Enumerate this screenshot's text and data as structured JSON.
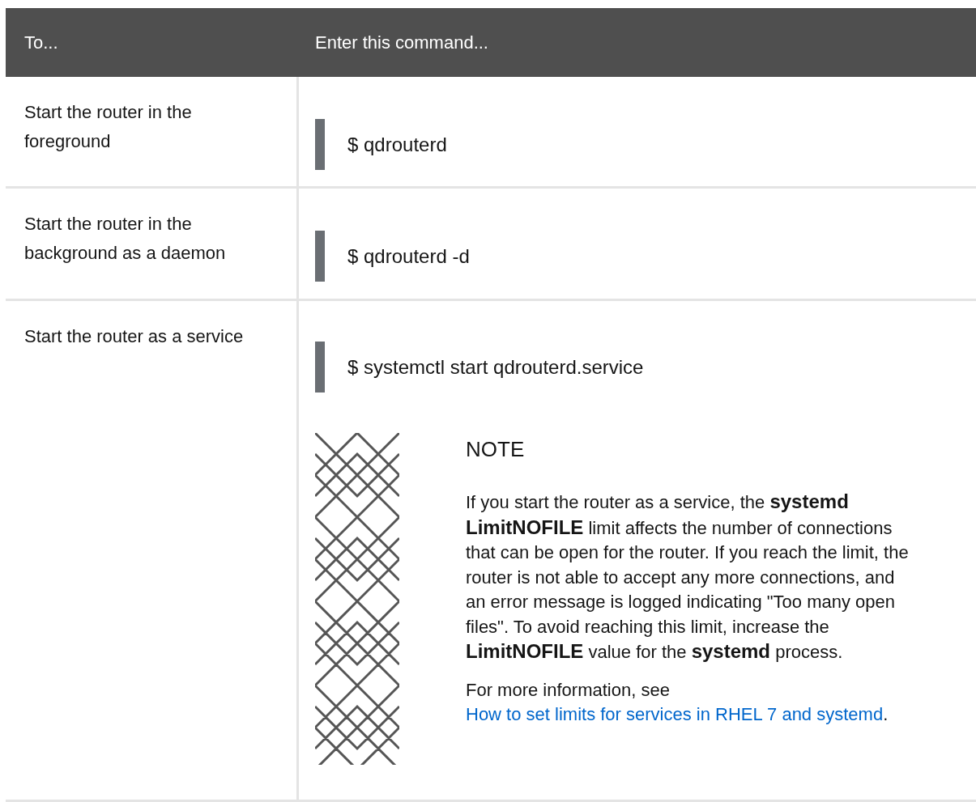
{
  "table": {
    "columns": [
      "To...",
      "Enter this command..."
    ],
    "rows": [
      {
        "task": "Start the router in the foreground",
        "command": "$ qdrouterd"
      },
      {
        "task": "Start the router in the background as a daemon",
        "command": "$ qdrouterd -d"
      },
      {
        "task": "Start the router as a service",
        "command": "$ systemctl start qdrouterd.service",
        "note": {
          "title": "NOTE",
          "body": "If you start the router as a service, the **systemd LimitNOFILE** limit affects the number of connections that can be open for the router. If you reach the limit, the router is not able to accept any more connections, and an error message is logged indicating \"Too many open files\". To avoid reaching this limit, increase the **LimitNOFILE** value for the **systemd** process.",
          "more": "For more information, see ",
          "link": "How to set limits for services in RHEL 7 and systemd",
          "after": "."
        }
      }
    ]
  }
}
